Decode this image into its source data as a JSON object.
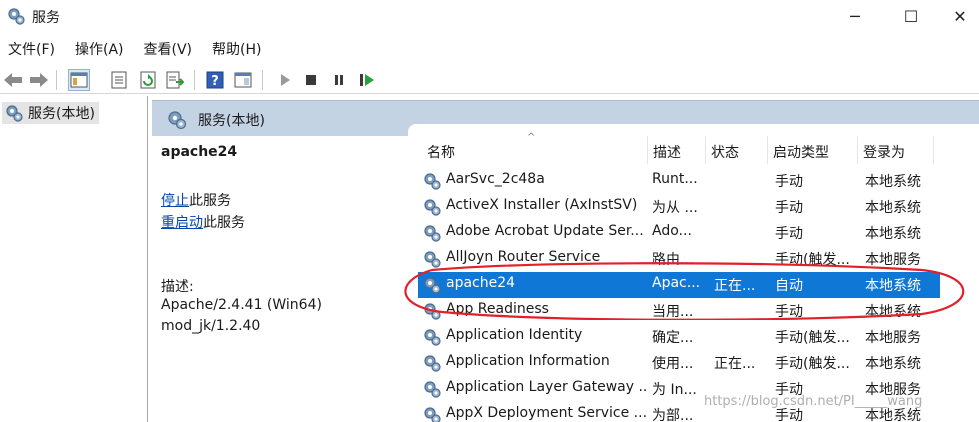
{
  "window": {
    "title": "服务",
    "min_glyph": "─",
    "max_glyph": "☐",
    "close_glyph": "✕"
  },
  "menu": [
    "文件(F)",
    "操作(A)",
    "查看(V)",
    "帮助(H)"
  ],
  "tree": {
    "root_label": "服务(本地)"
  },
  "panel": {
    "header": "服务(本地)"
  },
  "extended": {
    "service_name": "apache24",
    "stop_link": "停止",
    "stop_suffix": "此服务",
    "restart_link": "重启动",
    "restart_suffix": "此服务",
    "desc_label": "描述:",
    "desc_lines": [
      "Apache/2.4.41 (Win64)",
      "mod_jk/1.2.40"
    ]
  },
  "table": {
    "sort_indicator": "^",
    "columns": [
      "名称",
      "描述",
      "状态",
      "启动类型",
      "登录为"
    ],
    "rows": [
      [
        "AarSvc_2c48a",
        "Runt...",
        "",
        "手动",
        "本地系统"
      ],
      [
        "ActiveX Installer (AxInstSV)",
        "为从 ...",
        "",
        "手动",
        "本地系统"
      ],
      [
        "Adobe Acrobat Update Ser...",
        "Ado...",
        "",
        "手动",
        "本地系统"
      ],
      [
        "AllJoyn Router Service",
        "路由...",
        "",
        "手动(触发...",
        "本地服务"
      ],
      [
        "apache24",
        "Apac...",
        "正在...",
        "自动",
        "本地系统"
      ],
      [
        "App Readiness",
        "当用...",
        "",
        "手动",
        "本地系统"
      ],
      [
        "Application Identity",
        "确定...",
        "",
        "手动(触发...",
        "本地服务"
      ],
      [
        "Application Information",
        "使用...",
        "正在...",
        "手动(触发...",
        "本地系统"
      ],
      [
        "Application Layer Gateway ...",
        "为 In...",
        "",
        "手动",
        "本地服务"
      ],
      [
        "AppX Deployment Service ...",
        "为部...",
        "",
        "手动",
        "本地系统"
      ]
    ],
    "selected_index": 4
  },
  "watermark": "https://blog.csdn.net/PI_____wang",
  "colors": {
    "selection": "#0f78d7",
    "header_band": "#c4d3e4",
    "annotation": "#e2202a",
    "link": "#0645ad"
  },
  "icons": {
    "service": "gear-icon",
    "back": "back-arrow-icon",
    "forward": "forward-arrow-icon",
    "play": "play-icon",
    "stop": "stop-icon",
    "pause": "pause-icon",
    "resume": "resume-icon"
  }
}
